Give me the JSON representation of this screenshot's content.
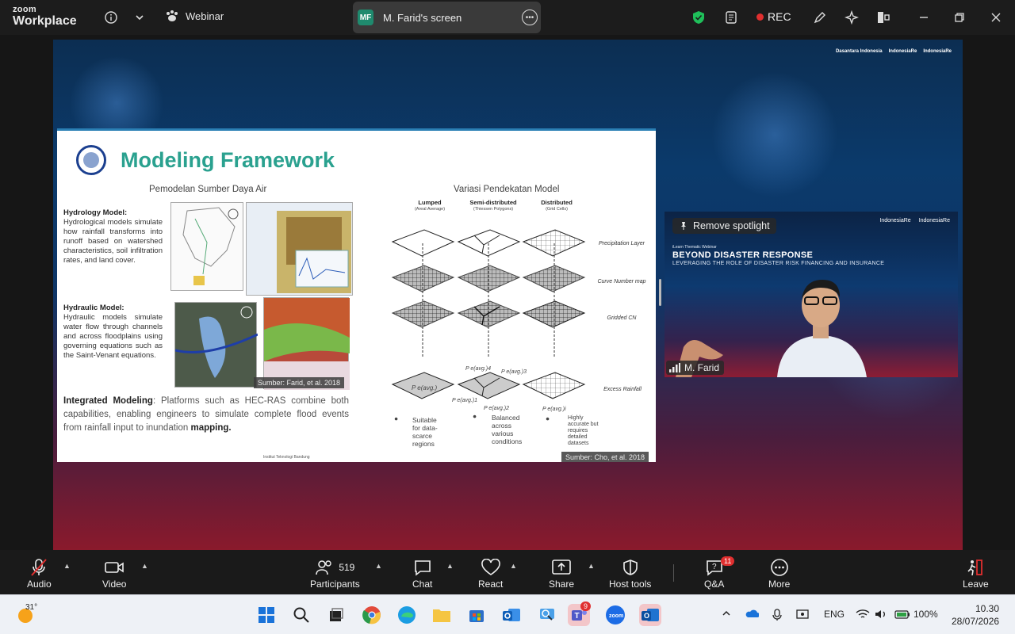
{
  "app": {
    "logo_line1": "zoom",
    "logo_line2": "Workplace",
    "meeting_type": "Webinar"
  },
  "share": {
    "initials": "MF",
    "title": "M. Farid's screen"
  },
  "recording": {
    "label": "REC"
  },
  "slide": {
    "title": "Modeling Framework",
    "left_heading": "Pemodelan Sumber Daya Air",
    "right_heading": "Variasi Pendekatan Model",
    "hydrology_title": "Hydrology Model:",
    "hydrology_text": "Hydrological models simulate how rainfall transforms into runoff based on watershed characteristics, soil infiltration rates, and land cover.",
    "hydraulic_title": "Hydraulic Model:",
    "hydraulic_text": "Hydraulic models simulate water flow through channels and across floodplains using governing equations such as the Saint-Venant equations.",
    "integrated_title": "Integrated Modeling",
    "integrated_text": ": Platforms such as HEC-RAS combine both capabilities, enabling engineers to simulate complete flood events from rainfall input to inundation ",
    "integrated_bold_end": "mapping.",
    "caption_left": "Sumber: Farid, et al. 2018",
    "caption_right": "Sumber: Cho, et al. 2018",
    "footer": "Institut Teknologi Bandung",
    "columns": [
      {
        "name": "Lumped",
        "sub": "(Areal Average)"
      },
      {
        "name": "Semi-distributed",
        "sub": "(Thiessen Polygons)"
      },
      {
        "name": "Distributed",
        "sub": "(Grid Cells)"
      }
    ],
    "layers": [
      "Precipitation Layer",
      "Curve Number map",
      "Gridded CN",
      "Excess Rainfall"
    ],
    "notes": [
      "Suitable for data-scarce regions",
      "Balanced across various conditions",
      "Highly accurate but requires detailed datasets"
    ],
    "p_labels": [
      "P e(avg.)",
      "P e(avg.)4",
      "P e(avg.)3",
      "P e(avg.)1",
      "P e(avg.)2",
      "P e(avg.)i"
    ]
  },
  "background_logos": [
    "Dasantara Indonesia",
    "IndonesiaRe",
    "IndonesiaRe"
  ],
  "video": {
    "spotlight_label": "Remove spotlight",
    "small": "iLearn Thematic Webinar",
    "title": "BEYOND DISASTER RESPONSE",
    "subtitle": "LEVERAGING THE ROLE OF DISASTER RISK FINANCING AND INSURANCE",
    "logo_a": "IndonesiaRe",
    "logo_b": "IndonesiaRe",
    "name": "M. Farid"
  },
  "toolbar": {
    "audio": "Audio",
    "video": "Video",
    "participants": "Participants",
    "participants_count": "519",
    "chat": "Chat",
    "react": "React",
    "share": "Share",
    "host_tools": "Host tools",
    "qa": "Q&A",
    "qa_badge": "11",
    "more": "More",
    "leave": "Leave"
  },
  "taskbar": {
    "weather": "31°",
    "teams_badge": "9",
    "lang": "ENG",
    "battery": "100%",
    "time": "10.30",
    "date": "28/07/2026"
  },
  "colors": {
    "accent_teal": "#2aa18f",
    "rec_red": "#e02f2f",
    "shield_green": "#1fbf5a"
  }
}
